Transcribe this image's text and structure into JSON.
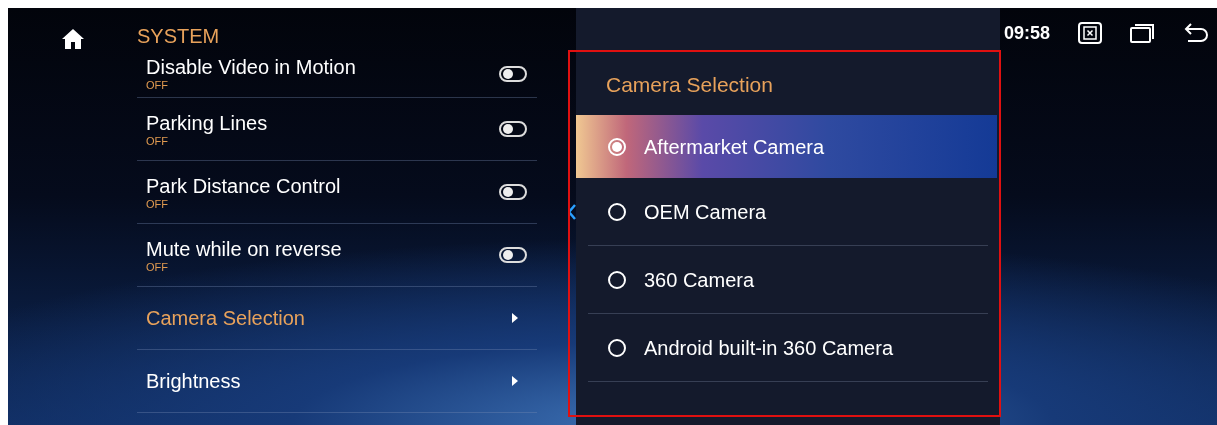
{
  "header": {
    "title": "SYSTEM"
  },
  "settings": [
    {
      "kind": "toggle",
      "label": "Disable Video in Motion",
      "value": "OFF",
      "on": false,
      "selected": false
    },
    {
      "kind": "toggle",
      "label": "Parking Lines",
      "value": "OFF",
      "on": false,
      "selected": false
    },
    {
      "kind": "toggle",
      "label": "Park Distance Control",
      "value": "OFF",
      "on": false,
      "selected": false
    },
    {
      "kind": "toggle",
      "label": "Mute while on reverse",
      "value": "OFF",
      "on": false,
      "selected": false
    },
    {
      "kind": "submenu",
      "label": "Camera Selection",
      "selected": true
    },
    {
      "kind": "submenu",
      "label": "Brightness",
      "selected": false
    }
  ],
  "dialog": {
    "title": "Camera Selection",
    "options": [
      {
        "label": "Aftermarket Camera",
        "selected": true
      },
      {
        "label": "OEM Camera",
        "selected": false
      },
      {
        "label": "360 Camera",
        "selected": false
      },
      {
        "label": "Android built-in 360 Camera",
        "selected": false
      }
    ]
  },
  "status_bar": {
    "time": "09:58"
  }
}
